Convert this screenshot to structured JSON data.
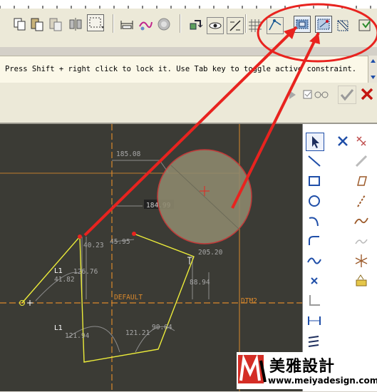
{
  "message_bar": {
    "text": "Press Shift + right click to lock it. Use Tab key to toggle active constraint."
  },
  "canvas": {
    "dimensions": [
      "185.08",
      "184.99",
      "45.95",
      "40.23",
      "126.76",
      "41.82",
      "205.20",
      "88.94",
      "121.94",
      "121.21",
      "90.04"
    ],
    "datum_labels": [
      "DEFAULT",
      "DTM2"
    ],
    "constraint_markers": [
      "L1",
      "L1"
    ]
  },
  "logo": {
    "brand": "美雅設計",
    "url": "www.meiyadesign.com"
  },
  "colors": {
    "annotation": "#e8231f",
    "sketch": "#ecec3a",
    "datum": "#d9882c",
    "dimension": "#a8a8a8",
    "canvas_bg": "#3b3b35"
  },
  "icons": {
    "toolbar": [
      "copy-icon",
      "paste-icon",
      "paste-special-icon",
      "mirror-icon",
      "select-box-icon",
      "dimension-icon",
      "sketch-scribble-icon",
      "repaint-icon",
      "regenerate-icon",
      "view-manager-icon",
      "view-dim-icon",
      "view-constraint-icon",
      "view-grid-icon",
      "view-vertex-icon",
      "sketch-diagnostics-icon",
      "shade-closed-loop-icon",
      "highlight-open-ends-icon",
      "overlap-geometry-icon",
      "import-icon"
    ],
    "dashboard": [
      "play-icon",
      "glasses-icon",
      "accept-checkmark-icon",
      "cancel-x-icon"
    ],
    "right_panel": [
      "select-arrow-icon",
      "line-icon",
      "rectangle-icon",
      "circle-icon",
      "arc-icon",
      "fillet-icon",
      "spline-icon",
      "point-icon",
      "centerline-icon",
      "dimension-tool-icon",
      "modify-icon",
      "delete-segment-icon",
      "constraint-icon",
      "coordinate-system-icon",
      "palette-icon",
      "thicken-icon",
      "sketch-text-icon",
      "mirror-tool-icon",
      "divide-icon",
      "rotate-resize-icon"
    ]
  }
}
